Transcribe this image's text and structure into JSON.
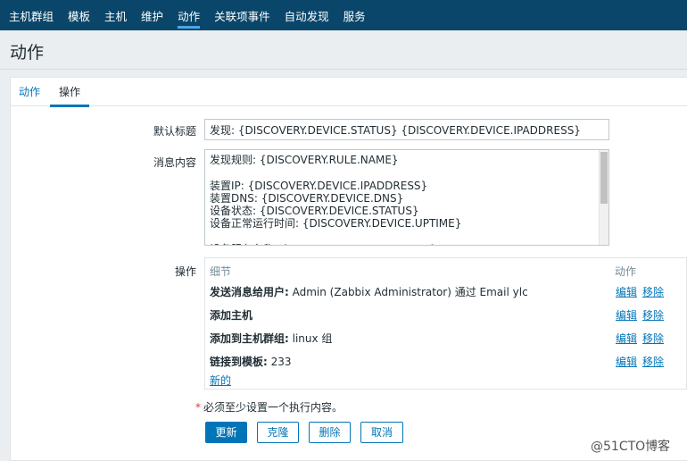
{
  "nav": {
    "items": [
      {
        "label": "主机群组",
        "active": false
      },
      {
        "label": "模板",
        "active": false
      },
      {
        "label": "主机",
        "active": false
      },
      {
        "label": "维护",
        "active": false
      },
      {
        "label": "动作",
        "active": true
      },
      {
        "label": "关联项事件",
        "active": false
      },
      {
        "label": "自动发现",
        "active": false
      },
      {
        "label": "服务",
        "active": false
      }
    ]
  },
  "page": {
    "title": "动作"
  },
  "tabs": [
    {
      "label": "动作"
    },
    {
      "label": "操作"
    }
  ],
  "form": {
    "default_subject_label": "默认标题",
    "default_subject_value": "发现: {DISCOVERY.DEVICE.STATUS} {DISCOVERY.DEVICE.IPADDRESS}",
    "message_label": "消息内容",
    "message_lines": [
      "发现规则: {DISCOVERY.RULE.NAME}",
      "",
      "装置IP: {DISCOVERY.DEVICE.IPADDRESS}",
      "装置DNS: {DISCOVERY.DEVICE.DNS}",
      "设备状态: {DISCOVERY.DEVICE.STATUS}",
      "设备正常运行时间: {DISCOVERY.DEVICE.UPTIME}",
      "",
      "设备服务名称: {DISCOVERY.SERVICE.NAME}"
    ],
    "operations_label": "操作"
  },
  "operations": {
    "col_details": "细节",
    "col_action": "动作",
    "rows": [
      {
        "title": "发送消息给用户:",
        "detail": " Admin (Zabbix Administrator) 通过 Email ylc",
        "edit": "编辑",
        "remove": "移除"
      },
      {
        "title": "添加主机",
        "detail": "",
        "edit": "编辑",
        "remove": "移除"
      },
      {
        "title": "添加到主机群组:",
        "detail": " linux 组",
        "edit": "编辑",
        "remove": "移除"
      },
      {
        "title": "链接到模板:",
        "detail": " 233",
        "edit": "编辑",
        "remove": "移除"
      }
    ],
    "new_link": "新的"
  },
  "required_note": "必须至少设置一个执行内容。",
  "buttons": {
    "update": "更新",
    "clone": "克隆",
    "delete": "删除",
    "cancel": "取消"
  },
  "watermark": "@51CTO博客"
}
